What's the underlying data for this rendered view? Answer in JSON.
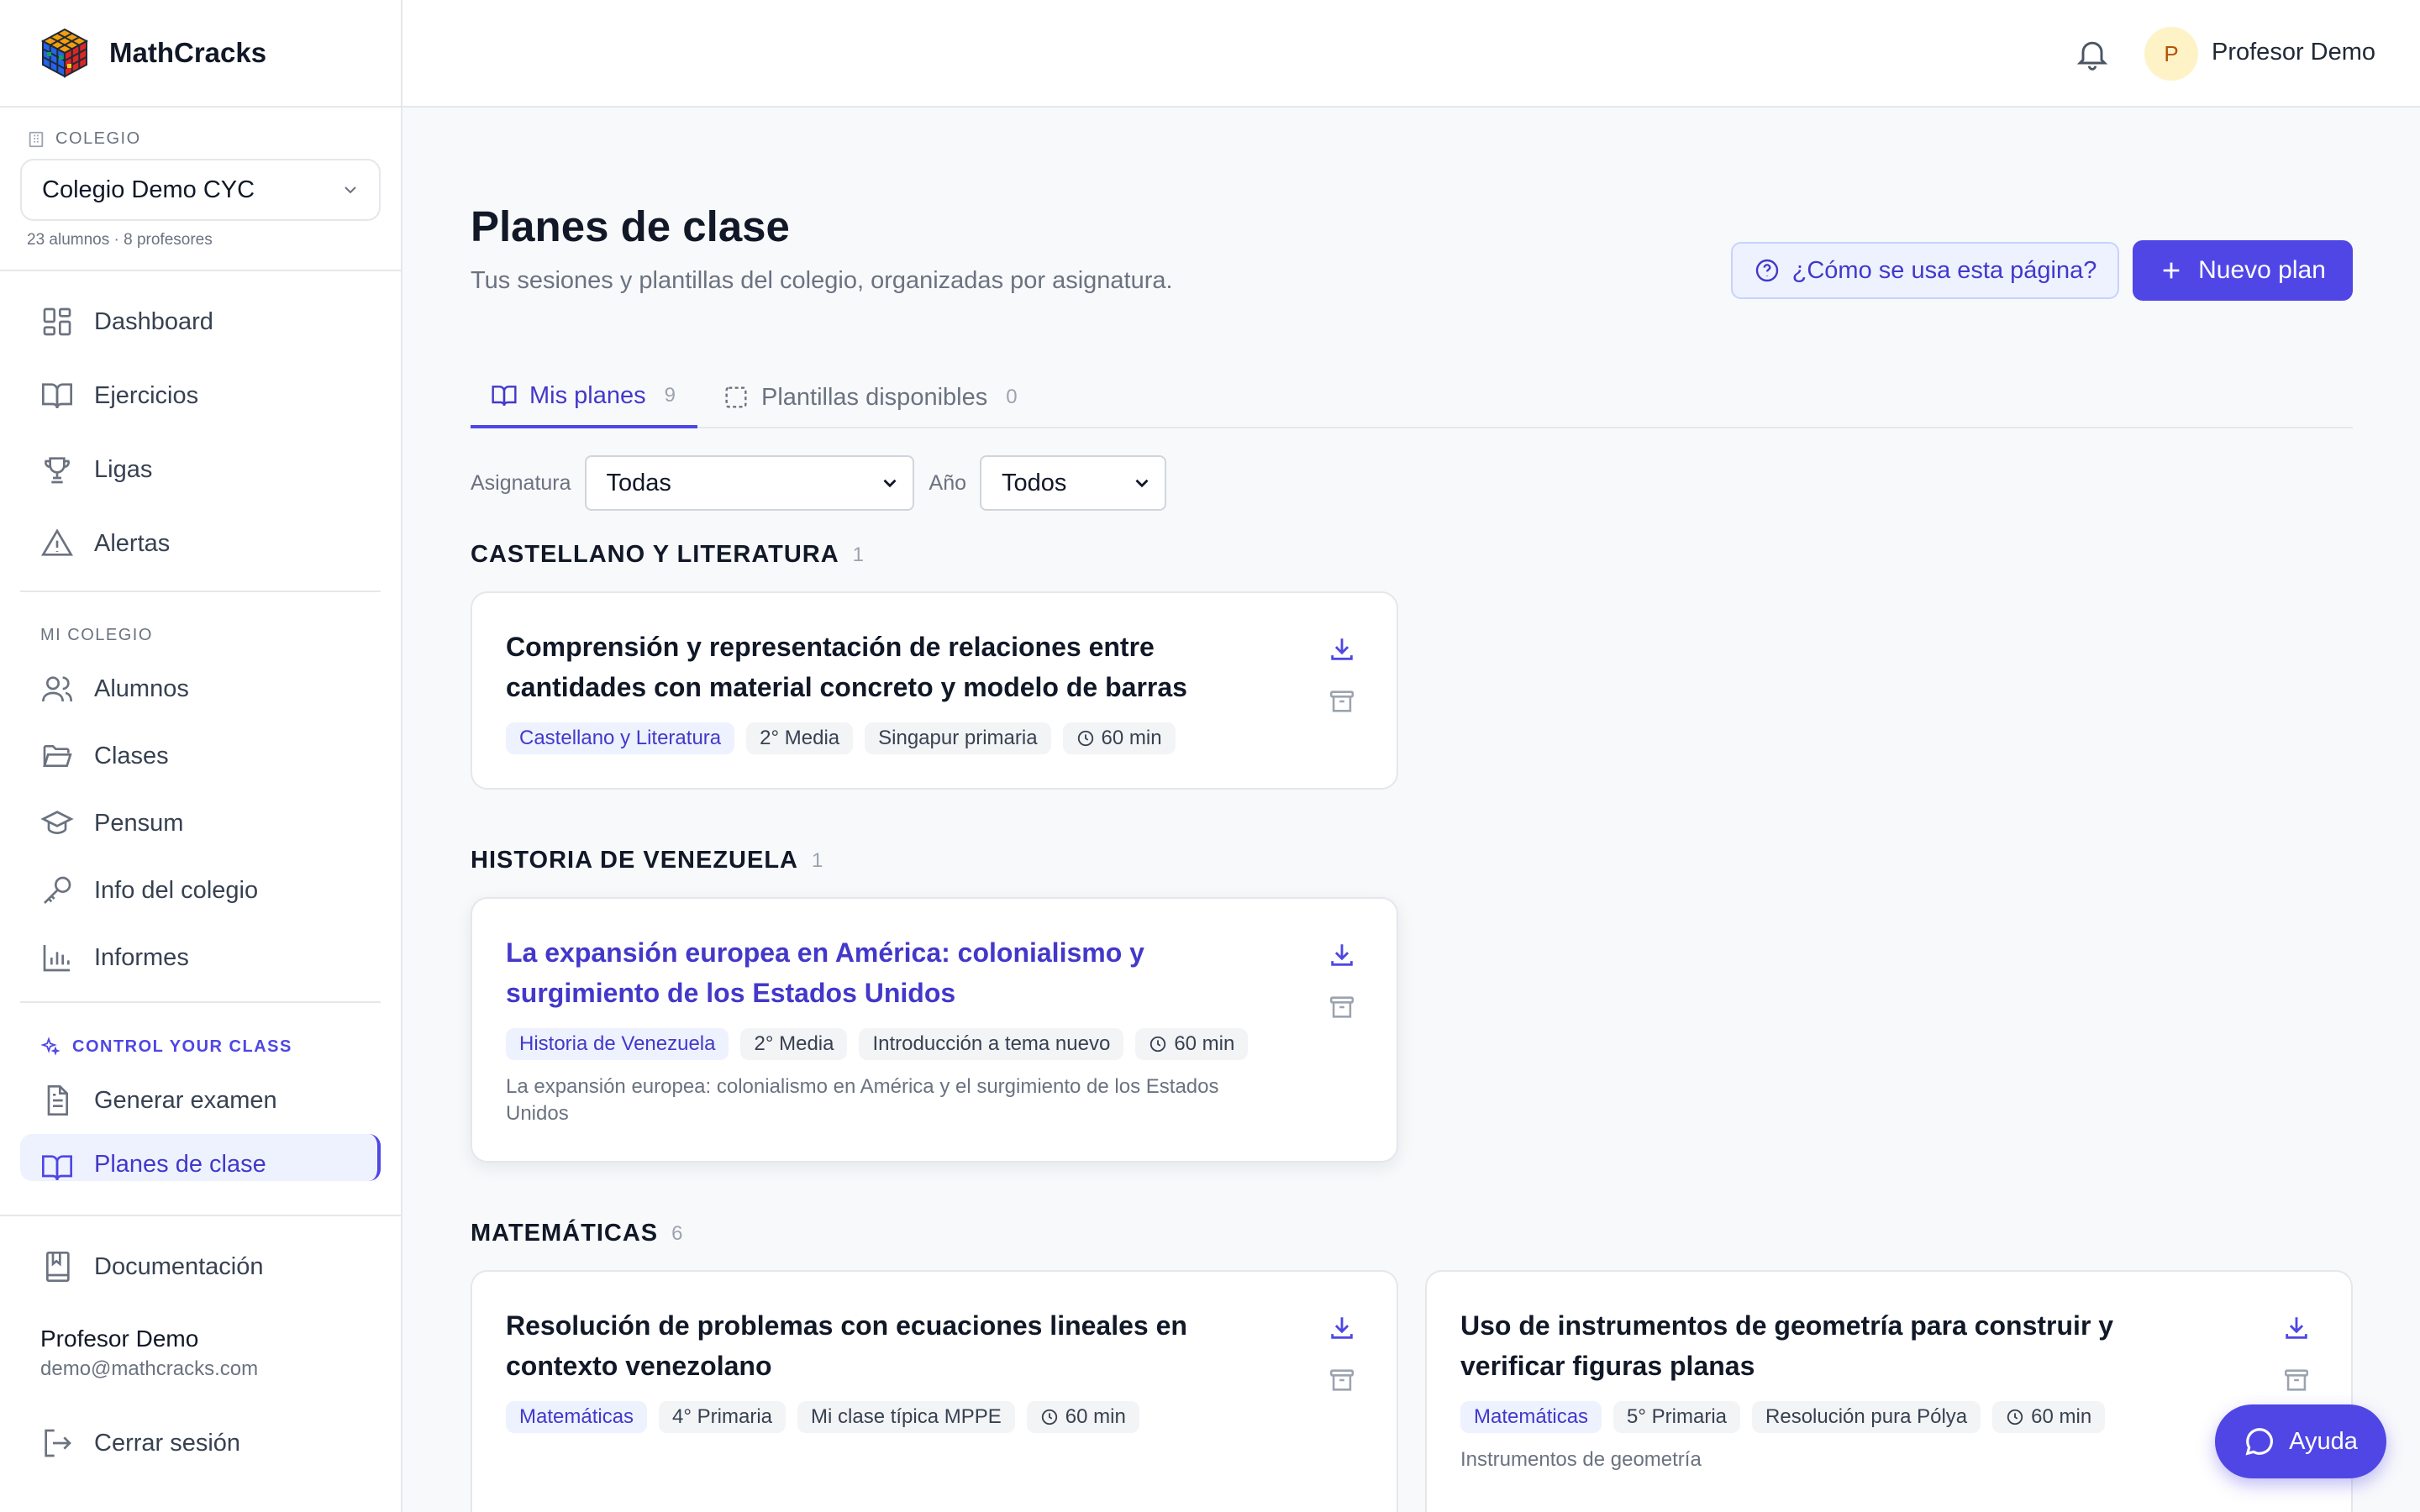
{
  "app": {
    "name": "MathCracks"
  },
  "school": {
    "label": "COLEGIO",
    "selected": "Colegio Demo CYC",
    "meta": "23 alumnos · 8 profesores"
  },
  "nav": {
    "dashboard": "Dashboard",
    "ejercicios": "Ejercicios",
    "ligas": "Ligas",
    "alertas": "Alertas",
    "mi_colegio_label": "MI COLEGIO",
    "alumnos": "Alumnos",
    "clases": "Clases",
    "pensum": "Pensum",
    "info": "Info del colegio",
    "informes": "Informes",
    "cyc_label": "CONTROL YOUR CLASS",
    "generar": "Generar examen",
    "planes": "Planes de clase",
    "documentacion": "Documentación",
    "cerrar": "Cerrar sesión"
  },
  "user": {
    "name": "Profesor Demo",
    "email": "demo@mathcracks.com",
    "initial": "P"
  },
  "page": {
    "title": "Planes de clase",
    "subtitle": "Tus sesiones y plantillas del colegio, organizadas por asignatura.",
    "help_label": "¿Cómo se usa esta página?",
    "new_label": "Nuevo plan"
  },
  "tabs": {
    "mine": {
      "label": "Mis planes",
      "count": "9"
    },
    "templates": {
      "label": "Plantillas disponibles",
      "count": "0"
    }
  },
  "filters": {
    "subject_label": "Asignatura",
    "subject_value": "Todas",
    "year_label": "Año",
    "year_value": "Todos"
  },
  "groups": {
    "castellano": {
      "title": "CASTELLANO Y LITERATURA",
      "count": "1"
    },
    "historia": {
      "title": "HISTORIA DE VENEZUELA",
      "count": "1"
    },
    "matematicas": {
      "title": "MATEMÁTICAS",
      "count": "6"
    }
  },
  "cards": {
    "c1": {
      "title": "Comprensión y representación de relaciones entre cantidades con material concreto y modelo de barras",
      "subject": "Castellano y Literatura",
      "grade": "2° Media",
      "method": "Singapur primaria",
      "duration": "60 min"
    },
    "c2": {
      "title": "La expansión europea en América: colonialismo y surgimiento de los Estados Unidos",
      "subject": "Historia de Venezuela",
      "grade": "2° Media",
      "method": "Introducción a tema nuevo",
      "duration": "60 min",
      "desc": "La expansión europea: colonialismo en América y el surgimiento de los Estados Unidos"
    },
    "c3": {
      "title": "Resolución de problemas con ecuaciones lineales en contexto venezolano",
      "subject": "Matemáticas",
      "grade": "4° Primaria",
      "method": "Mi clase típica MPPE",
      "duration": "60 min"
    },
    "c4": {
      "title": "Uso de instrumentos de geometría para construir y verificar figuras planas",
      "subject": "Matemáticas",
      "grade": "5° Primaria",
      "method": "Resolución pura Pólya",
      "duration": "60 min",
      "desc": "Instrumentos de geometría"
    }
  },
  "help_fab": "Ayuda",
  "colors": {
    "accent": "#4f46e5",
    "accent_dark": "#4338ca",
    "accent_soft": "#eef2ff",
    "avatar_bg": "#fef3c7"
  }
}
